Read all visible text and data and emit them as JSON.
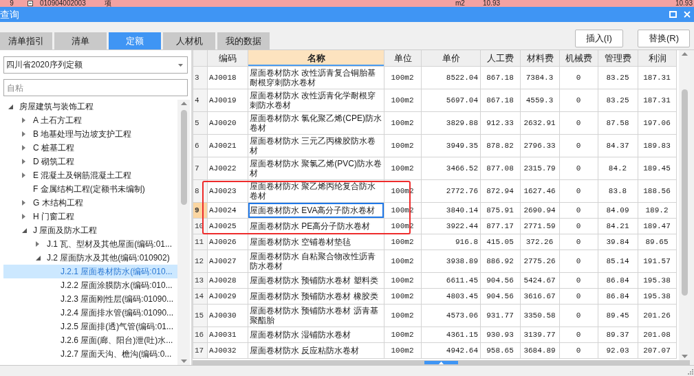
{
  "background_row": {
    "cells": [
      "9",
      "010904002003",
      "项",
      "m2",
      "10.93",
      "10.93"
    ]
  },
  "window": {
    "title": "查询"
  },
  "tabs": [
    {
      "label": "清单指引",
      "selected": false
    },
    {
      "label": "清单",
      "selected": false
    },
    {
      "label": "定额",
      "selected": true
    },
    {
      "label": "人材机",
      "selected": false
    },
    {
      "label": "我的数据",
      "selected": false
    }
  ],
  "actions": [
    "插入(I)",
    "替换(R)"
  ],
  "library_select": {
    "value": "四川省2020序列定额"
  },
  "search": {
    "placeholder": "自粘"
  },
  "tree": [
    {
      "label": "房屋建筑与装饰工程",
      "expanded": true,
      "selected": false,
      "children": [
        {
          "label": "A 土石方工程",
          "expanded": false,
          "selected": false
        },
        {
          "label": "B 地基处理与边坡支护工程",
          "expanded": false,
          "selected": false
        },
        {
          "label": "C 桩基工程",
          "expanded": false,
          "selected": false
        },
        {
          "label": "D 砌筑工程",
          "expanded": false,
          "selected": false
        },
        {
          "label": "E 混凝土及钢筋混凝土工程",
          "expanded": false,
          "selected": false
        },
        {
          "label": "F 金属结构工程(定额书未编制)",
          "selected": false
        },
        {
          "label": "G 木结构工程",
          "expanded": false,
          "selected": false
        },
        {
          "label": "H 门窗工程",
          "expanded": false,
          "selected": false
        },
        {
          "label": "J 屋面及防水工程",
          "expanded": true,
          "selected": false,
          "children": [
            {
              "label": "J.1 瓦、型材及其他屋面(编码:01...",
              "expanded": false,
              "selected": false
            },
            {
              "label": "J.2 屋面防水及其他(编码:010902)",
              "expanded": true,
              "selected": false,
              "children": [
                {
                  "label": "J.2.1 屋面卷材防水(编码:010...",
                  "selected": true
                },
                {
                  "label": "J.2.2 屋面涂膜防水(编码:010...",
                  "selected": false
                },
                {
                  "label": "J.2.3 屋面刚性层(编码:01090...",
                  "selected": false
                },
                {
                  "label": "J.2.4 屋面排水管(编码:01090...",
                  "selected": false
                },
                {
                  "label": "J.2.5 屋面排(透)气管(编码:01...",
                  "selected": false
                },
                {
                  "label": "J.2.6 屋面(廊、阳台)泄(吐)水...",
                  "selected": false
                },
                {
                  "label": "J.2.7 屋面天沟、檐沟(编码:0...",
                  "selected": false
                }
              ]
            }
          ]
        }
      ]
    }
  ],
  "table": {
    "columns": [
      {
        "label": "编码",
        "selected": false
      },
      {
        "label": "名称",
        "selected": true
      },
      {
        "label": "单位",
        "selected": false
      },
      {
        "label": "单价",
        "selected": false
      },
      {
        "label": "人工费",
        "selected": false
      },
      {
        "label": "材料费",
        "selected": false
      },
      {
        "label": "机械费",
        "selected": false
      },
      {
        "label": "管理费",
        "selected": false
      },
      {
        "label": "利润",
        "selected": false
      }
    ],
    "rows": [
      {
        "number": "3",
        "cells": [
          "AJ0018",
          "屋面卷材防水 改性沥青复合铜胎基耐根穿刺防水卷材",
          "100m2",
          "8522.04",
          "867.18",
          "7384.3",
          "0",
          "83.25",
          "187.31"
        ],
        "selected": false,
        "highlighted": false
      },
      {
        "number": "4",
        "cells": [
          "AJ0019",
          "屋面卷材防水 改性沥青化学耐根穿刺防水卷材",
          "100m2",
          "5697.04",
          "867.18",
          "4559.3",
          "0",
          "83.25",
          "187.31"
        ],
        "selected": false,
        "highlighted": false
      },
      {
        "number": "5",
        "cells": [
          "AJ0020",
          "屋面卷材防水 氯化聚乙烯(CPE)防水卷材",
          "100m2",
          "3829.88",
          "912.33",
          "2632.91",
          "0",
          "87.58",
          "197.06"
        ],
        "selected": false,
        "highlighted": false
      },
      {
        "number": "6",
        "cells": [
          "AJ0021",
          "屋面卷材防水 三元乙丙橡胶防水卷材",
          "100m2",
          "3949.35",
          "878.82",
          "2796.33",
          "0",
          "84.37",
          "189.83"
        ],
        "selected": false,
        "highlighted": false
      },
      {
        "number": "7",
        "cells": [
          "AJ0022",
          "屋面卷材防水 聚氯乙烯(PVC)防水卷材",
          "100m2",
          "3466.52",
          "877.08",
          "2315.79",
          "0",
          "84.2",
          "189.45"
        ],
        "selected": false,
        "highlighted": false
      },
      {
        "number": "8",
        "cells": [
          "AJ0023",
          "屋面卷材防水 聚乙烯丙纶复合防水卷材",
          "100m2",
          "2772.76",
          "872.94",
          "1627.46",
          "0",
          "83.8",
          "188.56"
        ],
        "selected": false,
        "highlighted": true
      },
      {
        "number": "9",
        "cells": [
          "AJ0024",
          "屋面卷材防水 EVA高分子防水卷材",
          "100m2",
          "3840.14",
          "875.91",
          "2690.94",
          "0",
          "84.09",
          "189.2"
        ],
        "selected": true,
        "highlighted": true
      },
      {
        "number": "10",
        "cells": [
          "AJ0025",
          "屋面卷材防水 PE高分子防水卷材",
          "100m2",
          "3922.44",
          "877.17",
          "2771.59",
          "0",
          "84.21",
          "189.47"
        ],
        "selected": false,
        "highlighted": true
      },
      {
        "number": "11",
        "cells": [
          "AJ0026",
          "屋面卷材防水 空铺卷材垫毡",
          "100m2",
          "916.8",
          "415.05",
          "372.26",
          "0",
          "39.84",
          "89.65"
        ],
        "selected": false,
        "highlighted": false
      },
      {
        "number": "12",
        "cells": [
          "AJ0027",
          "屋面卷材防水 自粘聚合物改性沥青防水卷材",
          "100m2",
          "3938.89",
          "886.92",
          "2775.26",
          "0",
          "85.14",
          "191.57"
        ],
        "selected": false,
        "highlighted": false
      },
      {
        "number": "13",
        "cells": [
          "AJ0028",
          "屋面卷材防水 预铺防水卷材 塑料类",
          "100m2",
          "6611.45",
          "904.56",
          "5424.67",
          "0",
          "86.84",
          "195.38"
        ],
        "selected": false,
        "highlighted": false
      },
      {
        "number": "14",
        "cells": [
          "AJ0029",
          "屋面卷材防水 预铺防水卷材 橡胶类",
          "100m2",
          "4803.45",
          "904.56",
          "3616.67",
          "0",
          "86.84",
          "195.38"
        ],
        "selected": false,
        "highlighted": false
      },
      {
        "number": "15",
        "cells": [
          "AJ0030",
          "屋面卷材防水 预铺防水卷材 沥青基聚酯胎",
          "100m2",
          "4573.06",
          "931.77",
          "3350.58",
          "0",
          "89.45",
          "201.26"
        ],
        "selected": false,
        "highlighted": false
      },
      {
        "number": "16",
        "cells": [
          "AJ0031",
          "屋面卷材防水 湿铺防水卷材",
          "100m2",
          "4361.15",
          "930.93",
          "3139.77",
          "0",
          "89.37",
          "201.08"
        ],
        "selected": false,
        "highlighted": false
      },
      {
        "number": "17",
        "cells": [
          "AJ0032",
          "屋面卷材防水 反应粘防水卷材",
          "100m2",
          "4942.64",
          "958.65",
          "3684.89",
          "0",
          "92.03",
          "207.07"
        ],
        "selected": false,
        "highlighted": false
      }
    ]
  }
}
